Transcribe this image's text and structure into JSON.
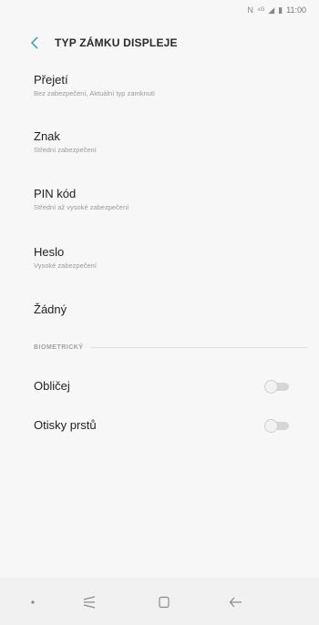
{
  "status_bar": {
    "time": "11:00"
  },
  "header": {
    "title": "TYP ZÁMKU DISPLEJE"
  },
  "options": [
    {
      "title": "Přejetí",
      "subtitle": "Bez zabezpečení, Aktuální typ zamknutí"
    },
    {
      "title": "Znak",
      "subtitle": "Střední zabezpečení"
    },
    {
      "title": "PIN kód",
      "subtitle": "Střední až vysoké zabezpečení"
    },
    {
      "title": "Heslo",
      "subtitle": "Vysoké zabezpečení"
    },
    {
      "title": "Žádný",
      "subtitle": ""
    }
  ],
  "biometrics": {
    "section_label": "BIOMETRICKÝ",
    "items": [
      {
        "title": "Obličej",
        "enabled": false
      },
      {
        "title": "Otisky prstů",
        "enabled": false
      }
    ]
  },
  "navbar": {
    "buttons": [
      "dot-icon",
      "recent-apps-icon",
      "home-icon",
      "back-icon"
    ]
  }
}
